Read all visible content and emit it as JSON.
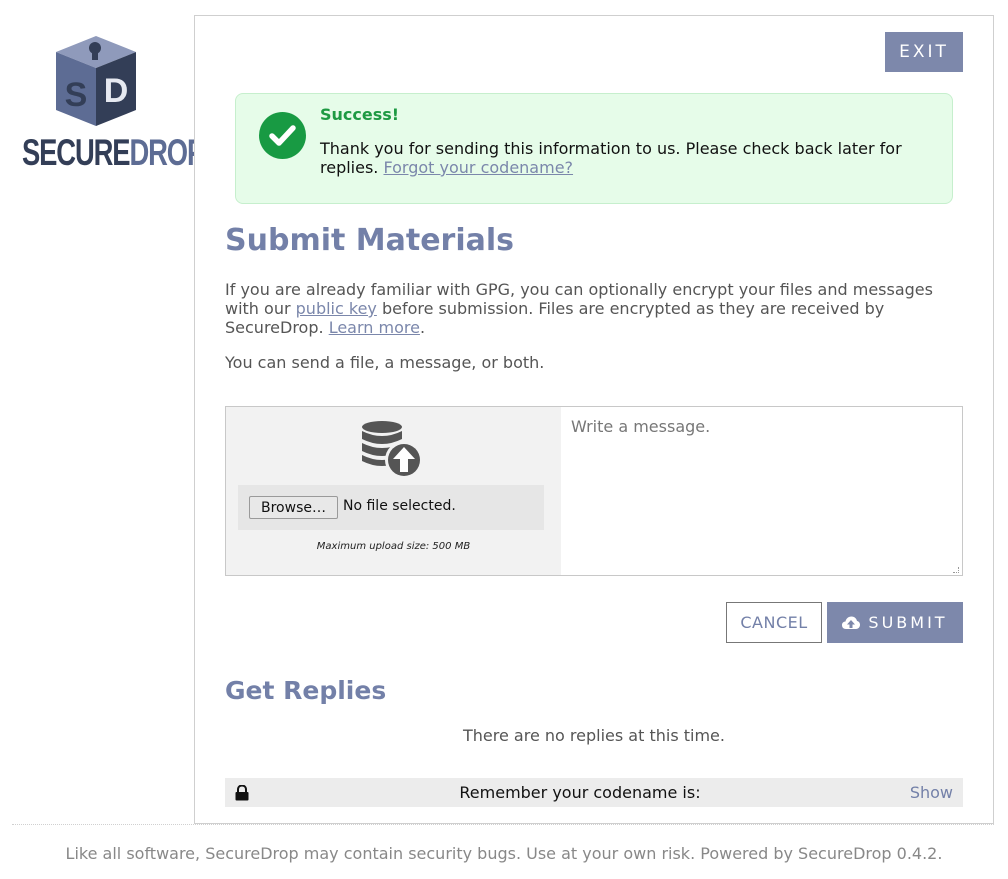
{
  "brand": {
    "logo_letters": "SD",
    "wordmark_part1": "SECURE",
    "wordmark_part2": "DROP",
    "colors": {
      "dark": "#333e57",
      "light": "#5d6c94",
      "cube_top": "#8f9abb"
    }
  },
  "header": {
    "exit_label": "EXIT"
  },
  "flash": {
    "icon": "check-circle-icon",
    "title": "Success!",
    "message": "Thank you for sending this information to us. Please check back later for replies.",
    "link": "Forgot your codename?",
    "color": "#189a43"
  },
  "submit": {
    "heading": "Submit Materials",
    "intro_before": "If you are already familiar with GPG, you can optionally encrypt your files and messages with our",
    "intro_link1": "public key",
    "intro_middle": "before submission. Files are encrypted as they are received by SecureDrop.",
    "intro_link2": "Learn more",
    "intro_end": ".",
    "send_hint": "You can send a file, a message, or both.",
    "upload_icon": "database-upload-icon",
    "browse_label": "Browse…",
    "file_status": "No file selected.",
    "max_size": "Maximum upload size: 500 MB",
    "message_placeholder": "Write a message.",
    "cancel_label": "CANCEL",
    "submit_label": "SUBMIT",
    "submit_icon": "cloud-upload-icon"
  },
  "replies": {
    "heading": "Get Replies",
    "empty_text": "There are no replies at this time.",
    "codename_icon": "lock-icon",
    "codename_label": "Remember your codename is:",
    "show_label": "Show"
  },
  "footer": {
    "text": "Like all software, SecureDrop may contain security bugs. Use at your own risk. Powered by SecureDrop 0.4.2."
  },
  "theme": {
    "accent": "#7d88ab",
    "heading": "#7380a8"
  }
}
